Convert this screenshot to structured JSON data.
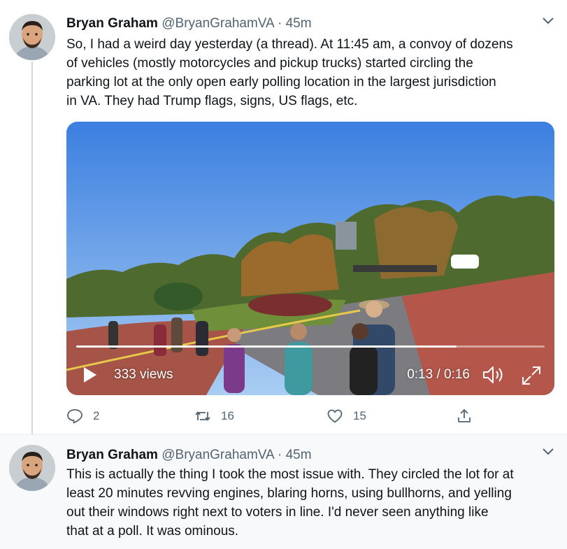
{
  "tweets": [
    {
      "author_name": "Bryan Graham",
      "handle": "@BryanGrahamVA",
      "separator": "·",
      "time": "45m",
      "text": "So, I had a weird day yesterday (a thread). At 11:45 am, a convoy of dozens\nof vehicles (mostly motorcycles and pickup trucks) started circling the\nparking lot at the only open early polling location in the largest jurisdiction\nin VA. They had Trump flags, signs, US flags, etc.",
      "video": {
        "views": "333 views",
        "time_display": "0:13 / 0:16",
        "progress": 0.8125
      },
      "actions": {
        "replies": "2",
        "retweets": "16",
        "likes": "15"
      }
    },
    {
      "author_name": "Bryan Graham",
      "handle": "@BryanGrahamVA",
      "separator": "·",
      "time": "45m",
      "text": "This is actually the thing I took the most issue with. They circled the lot for at\nleast 20 minutes revving engines, blaring horns, using bullhorns, and yelling\nout their windows right next to voters in line. I'd never seen anything like\nthat at a poll. It was ominous."
    }
  ],
  "icons": {
    "reply": "reply-icon",
    "retweet": "retweet-icon",
    "like": "heart-icon",
    "share": "share-icon",
    "caret": "chevron-down-icon",
    "play": "play-icon",
    "volume": "volume-icon",
    "fullscreen": "fullscreen-icon"
  },
  "colors": {
    "text_primary": "#0f1419",
    "text_secondary": "#536471",
    "thread_line": "#cfd9de",
    "second_tweet_bg": "#f7f9fa"
  }
}
